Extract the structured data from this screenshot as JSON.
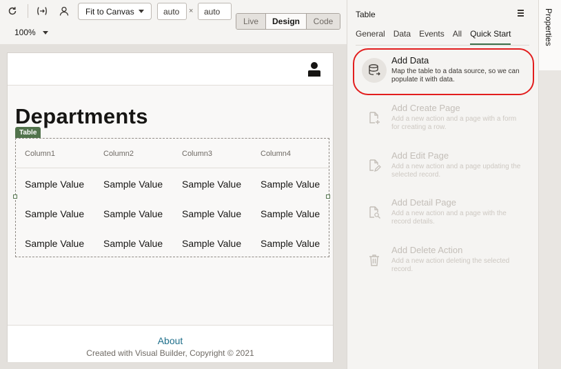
{
  "toolbar": {
    "fit_label": "Fit to Canvas",
    "width_value": "auto",
    "height_value": "auto",
    "times": "×",
    "modes": [
      "Live",
      "Design",
      "Code"
    ],
    "active_mode": "Design",
    "zoom": "100%",
    "icons": [
      "refresh-icon",
      "variables-icon",
      "user-icon"
    ]
  },
  "page": {
    "title": "Departments",
    "table_tag": "Table",
    "columns": [
      "Column1",
      "Column2",
      "Column3",
      "Column4"
    ],
    "rows": [
      [
        "Sample Value",
        "Sample Value",
        "Sample Value",
        "Sample Value"
      ],
      [
        "Sample Value",
        "Sample Value",
        "Sample Value",
        "Sample Value"
      ],
      [
        "Sample Value",
        "Sample Value",
        "Sample Value",
        "Sample Value"
      ]
    ],
    "footer": {
      "about": "About",
      "copyright": "Created with Visual Builder, Copyright © 2021"
    }
  },
  "properties": {
    "title": "Table",
    "tabs": [
      "General",
      "Data",
      "Events",
      "All",
      "Quick Start"
    ],
    "active_tab": "Quick Start",
    "quick_start": [
      {
        "title": "Add Data",
        "description": "Map the table to a data source, so we can populate it with data.",
        "icon": "database-icon",
        "enabled": true
      },
      {
        "title": "Add Create Page",
        "description": "Add a new action and a page with a form for creating a row.",
        "icon": "page-add-icon",
        "enabled": false
      },
      {
        "title": "Add Edit Page",
        "description": "Add a new action and a page updating the selected record.",
        "icon": "page-edit-icon",
        "enabled": false
      },
      {
        "title": "Add Detail Page",
        "description": "Add a new action and a page with the record details.",
        "icon": "page-search-icon",
        "enabled": false
      },
      {
        "title": "Add Delete Action",
        "description": "Add a new action deleting the selected record.",
        "icon": "trash-icon",
        "enabled": false
      }
    ],
    "side_tab": "Properties"
  },
  "colors": {
    "accent_green": "#52734c",
    "highlight_red": "#e21d1d",
    "link": "#1f6f8b"
  }
}
